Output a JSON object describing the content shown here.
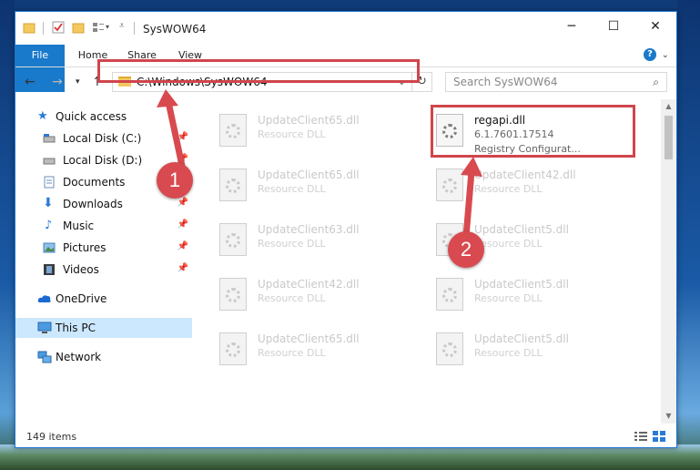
{
  "window": {
    "title": "SysWOW64"
  },
  "ribbon": {
    "tabs": [
      "File",
      "Home",
      "Share",
      "View"
    ]
  },
  "address": {
    "path": "C:\\Windows\\SysWOW64"
  },
  "search": {
    "placeholder": "Search SysWOW64"
  },
  "sidebar": {
    "items": [
      {
        "label": "Quick access",
        "icon": "star-icon",
        "pinned": false
      },
      {
        "label": "Local Disk (C:)",
        "icon": "drive-icon",
        "pinned": true
      },
      {
        "label": "Local Disk (D:)",
        "icon": "drive-icon",
        "pinned": true
      },
      {
        "label": "Documents",
        "icon": "documents-icon",
        "pinned": true
      },
      {
        "label": "Downloads",
        "icon": "download-icon",
        "pinned": true
      },
      {
        "label": "Music",
        "icon": "music-icon",
        "pinned": true
      },
      {
        "label": "Pictures",
        "icon": "pictures-icon",
        "pinned": true
      },
      {
        "label": "Videos",
        "icon": "videos-icon",
        "pinned": true
      },
      {
        "label": "OneDrive",
        "icon": "cloud-icon",
        "pinned": false
      },
      {
        "label": "This PC",
        "icon": "computer-icon",
        "pinned": false
      },
      {
        "label": "Network",
        "icon": "network-icon",
        "pinned": false
      }
    ]
  },
  "files": [
    {
      "name": "UpdateClient65.dll",
      "desc": "Resource DLL"
    },
    {
      "name": "UpdateClient65.dll",
      "desc": "Resource DLL"
    },
    {
      "name": "UpdateClient63.dll",
      "desc": "Resource DLL"
    },
    {
      "name": "UpdateClient42.dll",
      "desc": "Resource DLL"
    },
    {
      "name": "UpdateClient65.dll",
      "desc": "Resource DLL"
    },
    {
      "name": "regapi.dll",
      "desc": "6.1.7601.17514",
      "desc2": "Registry Configurat..."
    },
    {
      "name": "UpdateClient42.dll",
      "desc": "Resource DLL"
    },
    {
      "name": "UpdateClient5.dll",
      "desc": "Resource DLL"
    },
    {
      "name": "UpdateClient5.dll",
      "desc": "Resource DLL"
    },
    {
      "name": "UpdateClient5.dll",
      "desc": "Resource DLL"
    }
  ],
  "status": {
    "items_count": "149 items"
  },
  "annotations": {
    "step1": "1",
    "step2": "2"
  },
  "colors": {
    "accent": "#1979ca",
    "highlight": "#d0454c",
    "selected": "#cce8ff"
  }
}
